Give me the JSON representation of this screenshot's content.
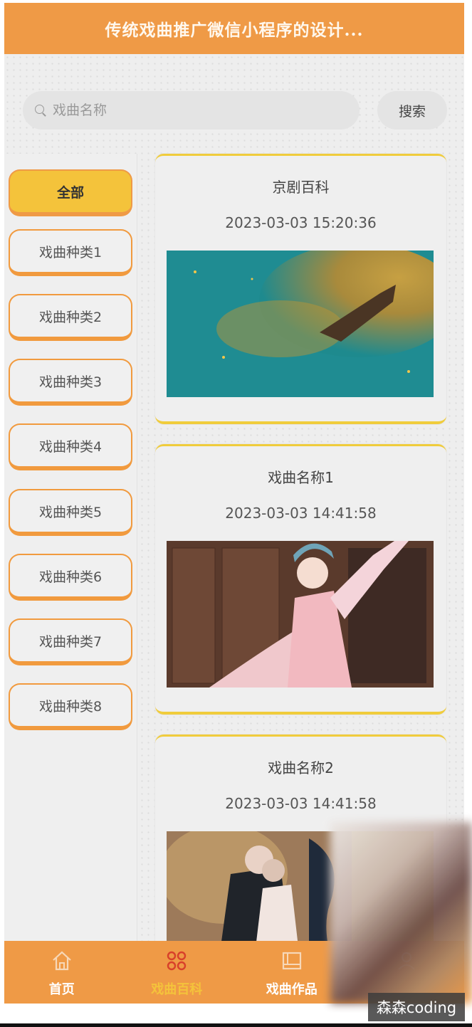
{
  "header": {
    "title": "传统戏曲推广微信小程序的设计..."
  },
  "search": {
    "placeholder": "戏曲名称",
    "button_label": "搜索"
  },
  "categories": [
    {
      "label": "全部",
      "active": true
    },
    {
      "label": "戏曲种类1"
    },
    {
      "label": "戏曲种类2"
    },
    {
      "label": "戏曲种类3"
    },
    {
      "label": "戏曲种类4"
    },
    {
      "label": "戏曲种类5"
    },
    {
      "label": "戏曲种类6"
    },
    {
      "label": "戏曲种类7"
    },
    {
      "label": "戏曲种类8"
    }
  ],
  "cards": [
    {
      "title": "京剧百科",
      "date": "2023-03-03 15:20:36",
      "image": "teal-gold-abstract"
    },
    {
      "title": "戏曲名称1",
      "date": "2023-03-03 14:41:58",
      "image": "opera-performer-pink"
    },
    {
      "title": "戏曲名称2",
      "date": "2023-03-03 14:41:58",
      "image": "opera-performers-stage"
    }
  ],
  "tabbar": {
    "items": [
      {
        "label": "首页",
        "icon": "home-icon"
      },
      {
        "label": "戏曲百科",
        "icon": "clover-grid-icon",
        "active": true
      },
      {
        "label": "戏曲作品",
        "icon": "book-icon"
      },
      {
        "label": "",
        "icon": "user-icon"
      }
    ]
  },
  "watermark": "森森coding",
  "colors": {
    "primary": "#ef9a46",
    "accent": "#f4c33b",
    "card_border": "#f0cc3c"
  }
}
